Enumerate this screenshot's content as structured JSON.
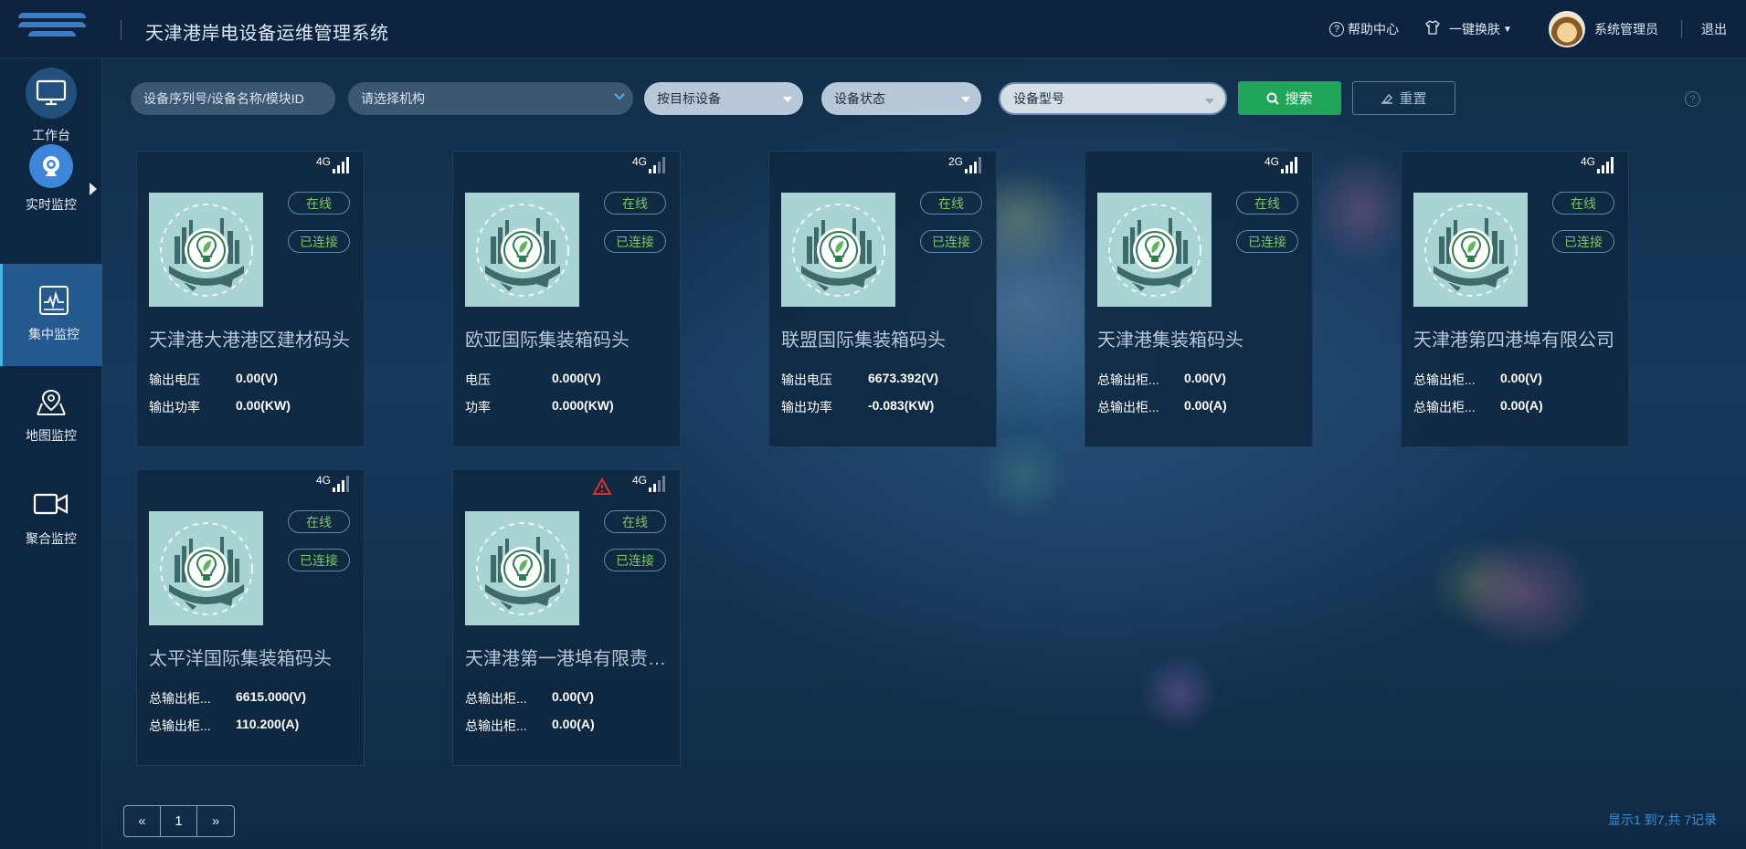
{
  "header": {
    "title": "天津港岸电设备运维管理系统",
    "help_label": "帮助中心",
    "skin_label": "一键换肤",
    "user_name": "系统管理员",
    "logout_label": "退出"
  },
  "sidebar": {
    "items": [
      {
        "label": "工作台",
        "icon": "monitor-icon"
      },
      {
        "label": "实时监控",
        "icon": "webcam-icon"
      },
      {
        "label": "集中监控",
        "icon": "dashboard-icon",
        "active": true
      },
      {
        "label": "地图监控",
        "icon": "map-pin-icon"
      },
      {
        "label": "聚合监控",
        "icon": "video-camera-icon"
      }
    ]
  },
  "filters": {
    "search_placeholder": "设备序列号/设备名称/模块ID",
    "org_placeholder": "请选择机构",
    "device_target": "按目标设备",
    "device_status": "设备状态",
    "device_model": "设备型号",
    "search_button": "搜索",
    "reset_button": "重置"
  },
  "cards": [
    {
      "signal": "4G",
      "bars": 4,
      "status": "在线",
      "connection": "已连接",
      "name": "天津港大港港区建材码头",
      "m1_label": "输出电压",
      "m1_value": "0.00(V)",
      "m2_label": "输出功率",
      "m2_value": "0.00(KW)",
      "warning": false
    },
    {
      "signal": "4G",
      "bars": 2,
      "status": "在线",
      "connection": "已连接",
      "name": "欧亚国际集装箱码头",
      "m1_label": "电压",
      "m1_value": "0.000(V)",
      "m2_label": "功率",
      "m2_value": "0.000(KW)",
      "warning": false
    },
    {
      "signal": "2G",
      "bars": 3,
      "status": "在线",
      "connection": "已连接",
      "name": "联盟国际集装箱码头",
      "m1_label": "输出电压",
      "m1_value": "6673.392(V)",
      "m2_label": "输出功率",
      "m2_value": "-0.083(KW)",
      "warning": false
    },
    {
      "signal": "4G",
      "bars": 4,
      "status": "在线",
      "connection": "已连接",
      "name": "天津港集装箱码头",
      "m1_label": "总输出柜...",
      "m1_value": "0.00(V)",
      "m2_label": "总输出柜...",
      "m2_value": "0.00(A)",
      "warning": false
    },
    {
      "signal": "4G",
      "bars": 4,
      "status": "在线",
      "connection": "已连接",
      "name": "天津港第四港埠有限公司",
      "m1_label": "总输出柜...",
      "m1_value": "0.00(V)",
      "m2_label": "总输出柜...",
      "m2_value": "0.00(A)",
      "warning": false
    },
    {
      "signal": "4G",
      "bars": 3,
      "status": "在线",
      "connection": "已连接",
      "name": "太平洋国际集装箱码头",
      "m1_label": "总输出柜...",
      "m1_value": "6615.000(V)",
      "m2_label": "总输出柜...",
      "m2_value": "110.200(A)",
      "warning": false
    },
    {
      "signal": "4G",
      "bars": 2,
      "status": "在线",
      "connection": "已连接",
      "name": "天津港第一港埠有限责任公司",
      "m1_label": "总输出柜...",
      "m1_value": "0.00(V)",
      "m2_label": "总输出柜...",
      "m2_value": "0.00(A)",
      "warning": true
    }
  ],
  "pagination": {
    "prev": "«",
    "current": "1",
    "next": "»",
    "info": "显示1 到7,共 7记录"
  },
  "colors": {
    "accent": "#3d86d9",
    "online": "#7cc765",
    "search_button": "#1fa65a",
    "warning": "#e0302a"
  }
}
